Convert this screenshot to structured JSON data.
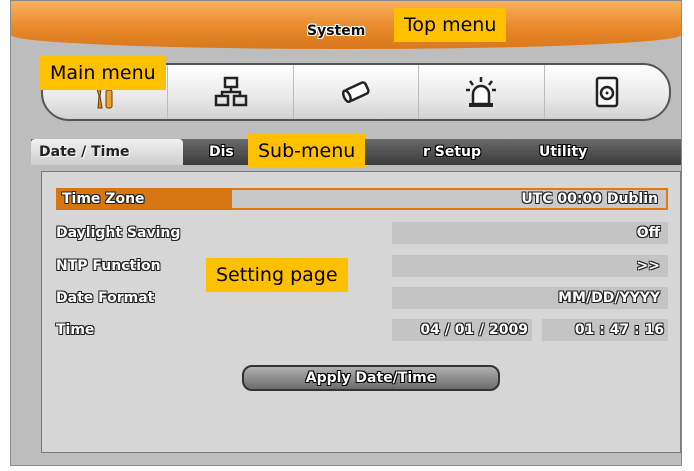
{
  "top_bar": {
    "title": "System"
  },
  "main_menu": {
    "icons": [
      {
        "name": "tools-icon",
        "active": true
      },
      {
        "name": "network-icon"
      },
      {
        "name": "camera-icon"
      },
      {
        "name": "alarm-icon"
      },
      {
        "name": "disk-icon"
      }
    ]
  },
  "sub_menu": {
    "tabs": [
      "Date / Time",
      "Dis",
      "r Setup",
      "Utility"
    ]
  },
  "settings": {
    "time_zone": {
      "label": "Time Zone",
      "value": "UTC 00:00 Dublin"
    },
    "daylight_saving": {
      "label": "Daylight Saving",
      "value": "Off"
    },
    "ntp_function": {
      "label": "NTP Function",
      "value": ">>"
    },
    "date_format": {
      "label": "Date Format",
      "value": "MM/DD/YYYY"
    },
    "time": {
      "label": "Time",
      "date": "04 / 01 /  2009",
      "clock": "01 : 47 : 16"
    },
    "apply_button": "Apply Date/Time"
  },
  "callouts": {
    "top_menu": "Top menu",
    "main_menu": "Main menu",
    "sub_menu": "Sub-menu",
    "setting_page": "Setting page"
  },
  "colors": {
    "accent": "#e8892a",
    "callout": "#ffc000",
    "selected": "#d57612"
  }
}
